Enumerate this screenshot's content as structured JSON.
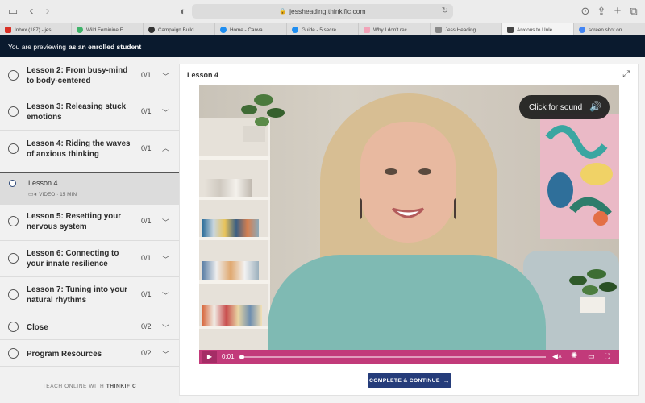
{
  "browser": {
    "url": "jessheading.thinkific.com",
    "tabs": [
      {
        "label": "Inbox (187) - jes...",
        "color": "#d93025"
      },
      {
        "label": "Wild Feminine E...",
        "color": "#3fb36a"
      },
      {
        "label": "Campaign Build...",
        "color": "#333333"
      },
      {
        "label": "Home - Canva",
        "color": "#1f8ef1"
      },
      {
        "label": "Guide - 5 secre...",
        "color": "#1f8ef1"
      },
      {
        "label": "Why I don't rec...",
        "color": "#f2a3b8"
      },
      {
        "label": "Jess Heading",
        "color": "#888888"
      },
      {
        "label": "Anxious to Unle...",
        "color": "#444444"
      },
      {
        "label": "screen shot on...",
        "color": "#4285f4"
      }
    ]
  },
  "banner": {
    "prefix": "You are previewing",
    "emphasis": "as an enrolled student"
  },
  "sidebar": {
    "chapters": [
      {
        "title": "Lesson 2: From busy-mind to body-centered",
        "count": "0/1",
        "chevron": "v"
      },
      {
        "title": "Lesson 3: Releasing stuck emotions",
        "count": "0/1",
        "chevron": "v"
      },
      {
        "title": "Lesson 4: Riding the waves of anxious thinking",
        "count": "0/1",
        "chevron": "^"
      },
      {
        "title": "Lesson 5: Resetting your nervous system",
        "count": "0/1",
        "chevron": "v"
      },
      {
        "title": "Lesson 6: Connecting to your innate resilience",
        "count": "0/1",
        "chevron": "v"
      },
      {
        "title": "Lesson 7: Tuning into your natural rhythms",
        "count": "0/1",
        "chevron": "v"
      },
      {
        "title": "Close",
        "count": "0/2",
        "chevron": "v"
      },
      {
        "title": "Program Resources",
        "count": "0/2",
        "chevron": "v"
      }
    ],
    "active_lesson": {
      "title": "Lesson 4",
      "meta": "VIDEO · 15 MIN"
    },
    "footer_prefix": "TEACH ONLINE WITH",
    "footer_brand": "THINKIFIC"
  },
  "main": {
    "title": "Lesson 4",
    "sound_prompt": "Click for sound",
    "video_time": "0:01",
    "video_progress": 0.0,
    "complete_label": "COMPLETE & CONTINUE",
    "accent": "#c23a7a",
    "button_color": "#253c7a"
  }
}
